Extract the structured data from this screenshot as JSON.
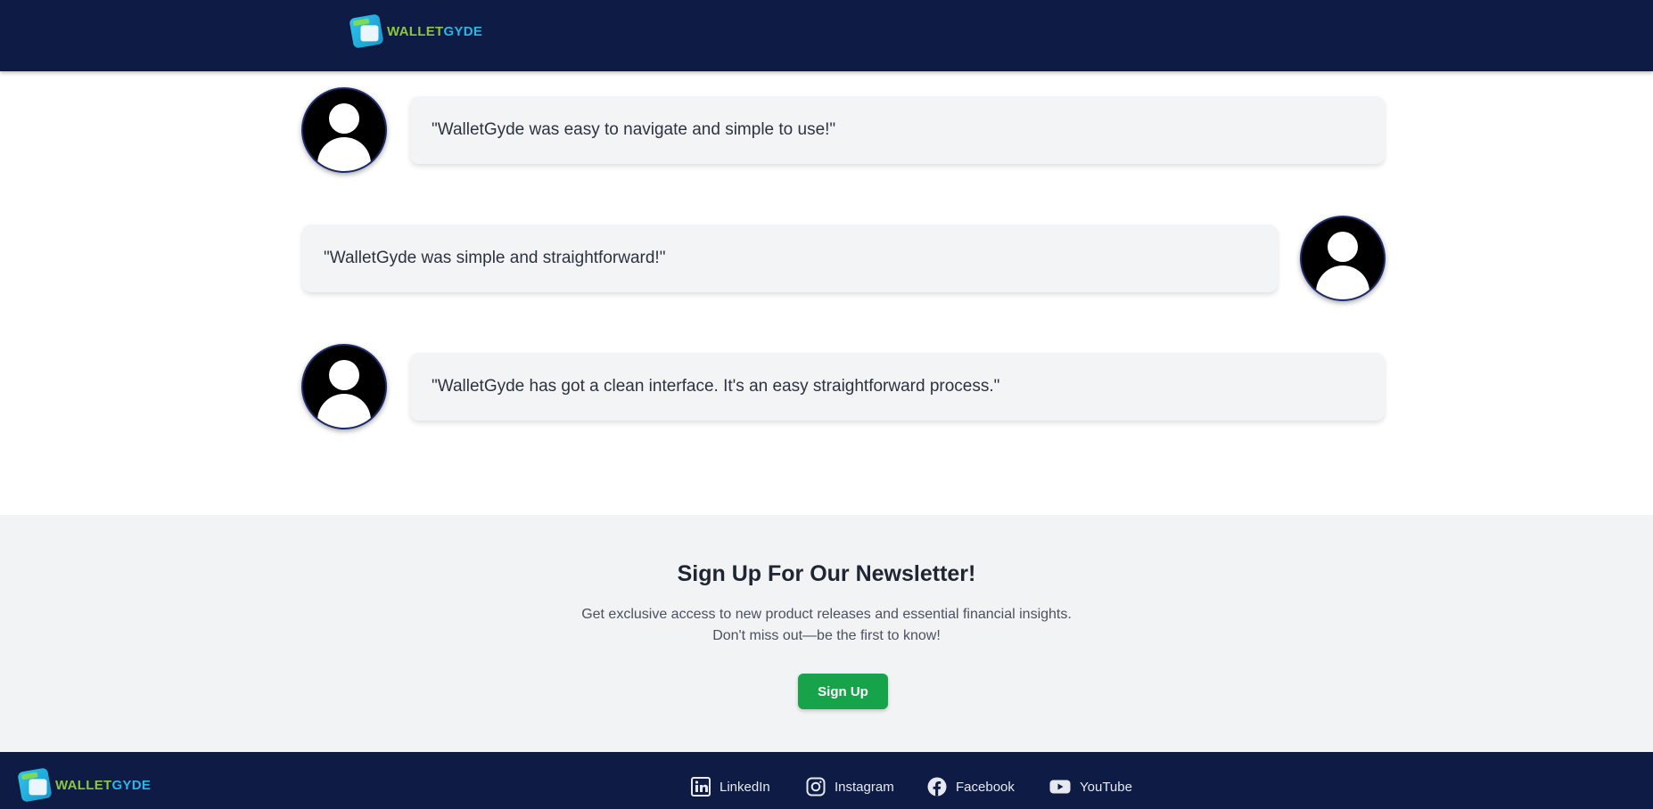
{
  "header": {
    "logo": {
      "text_a": "WALLET",
      "text_b": "GYDE",
      "icon": "wallet-icon"
    }
  },
  "testimonials": [
    {
      "quote": "\"WalletGyde was easy to navigate and simple to use!\""
    },
    {
      "quote": "\"WalletGyde was simple and straightforward!\""
    },
    {
      "quote": "\"WalletGyde has got a clean interface. It's an easy straightforward process.\""
    }
  ],
  "newsletter": {
    "title": "Sign Up For Our Newsletter!",
    "line1": "Get exclusive access to new product releases and essential financial insights.",
    "line2": "Don't miss out—be the first to know!",
    "button": "Sign Up"
  },
  "footer": {
    "logo": {
      "text_a": "WALLET",
      "text_b": "GYDE"
    },
    "social": [
      {
        "label": "LinkedIn",
        "icon": "linkedin-icon"
      },
      {
        "label": "Instagram",
        "icon": "instagram-icon"
      },
      {
        "label": "Facebook",
        "icon": "facebook-icon"
      },
      {
        "label": "YouTube",
        "icon": "youtube-icon"
      }
    ]
  },
  "colors": {
    "navy": "#0d1b45",
    "green_button": "#16a34a",
    "logo_green": "#8cc63f",
    "logo_blue": "#2cb5e8"
  }
}
